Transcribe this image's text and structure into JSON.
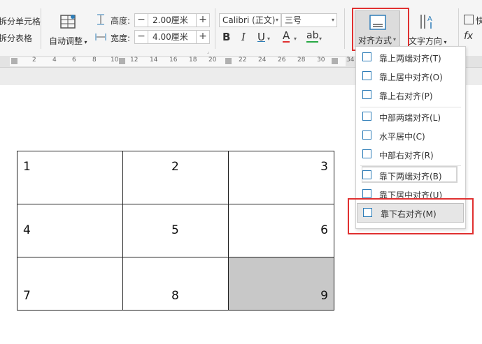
{
  "toolbar": {
    "split_cells": "拆分单元格",
    "split_table": "拆分表格",
    "auto_fit": "自动调整",
    "height_label": "高度:",
    "height_value": "2.00厘米",
    "width_label": "宽度:",
    "width_value": "4.00厘米",
    "font_name": "Calibri (正文)",
    "font_size": "三号",
    "align_label": "对齐方式",
    "text_direction": "文字方向",
    "quick_calc": "快",
    "formula": "fx",
    "minus": "−",
    "plus": "+",
    "bold": "B",
    "italic": "I",
    "underline": "U",
    "font_color": "A",
    "highlight": "ab"
  },
  "ruler": {
    "ticks": [
      "2",
      "4",
      "6",
      "8",
      "10",
      "12",
      "14",
      "16",
      "18",
      "20",
      "22",
      "24",
      "26",
      "28",
      "30",
      "34"
    ]
  },
  "align_menu": {
    "items": [
      {
        "label": "靠上两端对齐(T)"
      },
      {
        "label": "靠上居中对齐(O)"
      },
      {
        "label": "靠上右对齐(P)"
      },
      {
        "label": "中部两端对齐(L)"
      },
      {
        "label": "水平居中(C)"
      },
      {
        "label": "中部右对齐(R)"
      },
      {
        "label": "靠下两端对齐(B)"
      },
      {
        "label": "靠下居中对齐(U)"
      },
      {
        "label": "靠下右对齐(M)"
      }
    ]
  },
  "table": {
    "rows": [
      [
        "1",
        "2",
        "3"
      ],
      [
        "4",
        "5",
        "6"
      ],
      [
        "7",
        "8",
        "9"
      ]
    ],
    "selected_cell_color": "#c8c8c8"
  },
  "colors": {
    "highlight_red": "#e03030",
    "accent_blue": "#2e7db8"
  }
}
